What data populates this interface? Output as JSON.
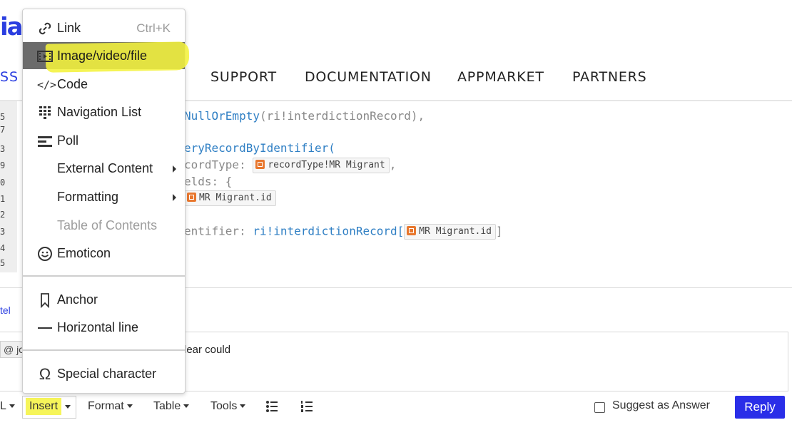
{
  "header": {
    "logo_text": "ia",
    "nav_partial": "SS",
    "nav_items": [
      "SUPPORT",
      "DOCUMENTATION",
      "APPMARKET",
      "PARTNERS"
    ]
  },
  "code": {
    "gutter_numbers": [
      "5",
      "7",
      "3",
      "9",
      "0",
      "1",
      "2",
      "3",
      "4",
      "5"
    ],
    "line1_fn": "NullOrEmpty",
    "line1_arg": "(ri!interdictionRecord),",
    "line2_fn": "eryRecordByIdentifier(",
    "line3_key": "cordType: ",
    "line3_chip": "recordType!MR Migrant",
    "line3_tail": ",",
    "line4_key": "elds: {",
    "line5_chip": "MR Migrant.id",
    "line6_key": "entifier: ",
    "line6_fn": "ri!interdictionRecord[",
    "line6_chip": "MR Migrant.id",
    "line6_tail": "]"
  },
  "misc": {
    "tel_text": "tel"
  },
  "editor": {
    "mention_text": "@ jo",
    "text_fragment": "lear could"
  },
  "toolbar": {
    "partial_label": "L",
    "insert_label": "Insert",
    "format_label": "Format",
    "table_label": "Table",
    "tools_label": "Tools",
    "suggest_label": "Suggest as Answer",
    "reply_label": "Reply"
  },
  "menu": {
    "link": "Link",
    "link_shortcut": "Ctrl+K",
    "image": "Image/video/file",
    "code": "Code",
    "navlist": "Navigation List",
    "poll": "Poll",
    "external": "External Content",
    "formatting": "Formatting",
    "toc": "Table of Contents",
    "emoticon": "Emoticon",
    "anchor": "Anchor",
    "hline": "Horizontal line",
    "special": "Special character"
  },
  "colors": {
    "brand": "#2a3ee0",
    "highlight": "#f4f23c",
    "reply_bg": "#2a2ee8",
    "selected_item_bg": "#6b6b6b"
  }
}
